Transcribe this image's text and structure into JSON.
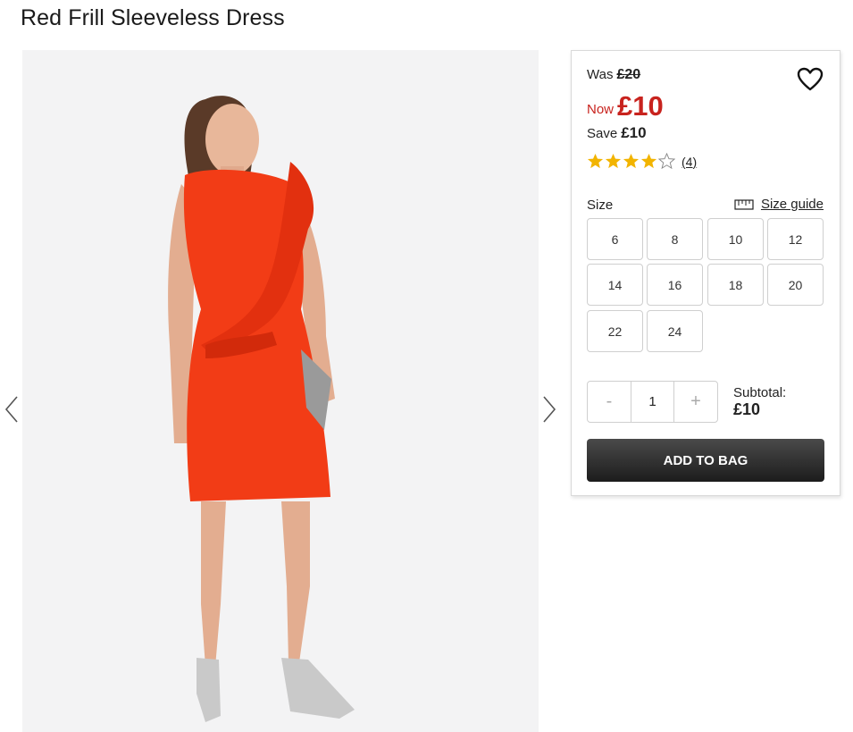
{
  "product": {
    "title": "Red Frill Sleeveless Dress"
  },
  "pricing": {
    "was_label": "Was",
    "was_price": "£20",
    "now_label": "Now",
    "now_price": "£10",
    "save_label": "Save",
    "save_amount": "£10",
    "now_color": "#c8231e"
  },
  "rating": {
    "stars": 4,
    "max_stars": 5,
    "review_count": "(4)",
    "star_color": "#f2b400"
  },
  "size": {
    "label": "Size",
    "guide_label": "Size guide",
    "options": [
      "6",
      "8",
      "10",
      "12",
      "14",
      "16",
      "18",
      "20",
      "22",
      "24"
    ]
  },
  "quantity": {
    "minus": "-",
    "value": "1",
    "plus": "+"
  },
  "subtotal": {
    "label": "Subtotal:",
    "value": "£10"
  },
  "add_to_bag": {
    "label": "ADD TO BAG"
  },
  "icons": {
    "wishlist": "heart-icon",
    "size_guide": "ruler-icon",
    "prev": "chevron-left-icon",
    "next": "chevron-right-icon"
  }
}
